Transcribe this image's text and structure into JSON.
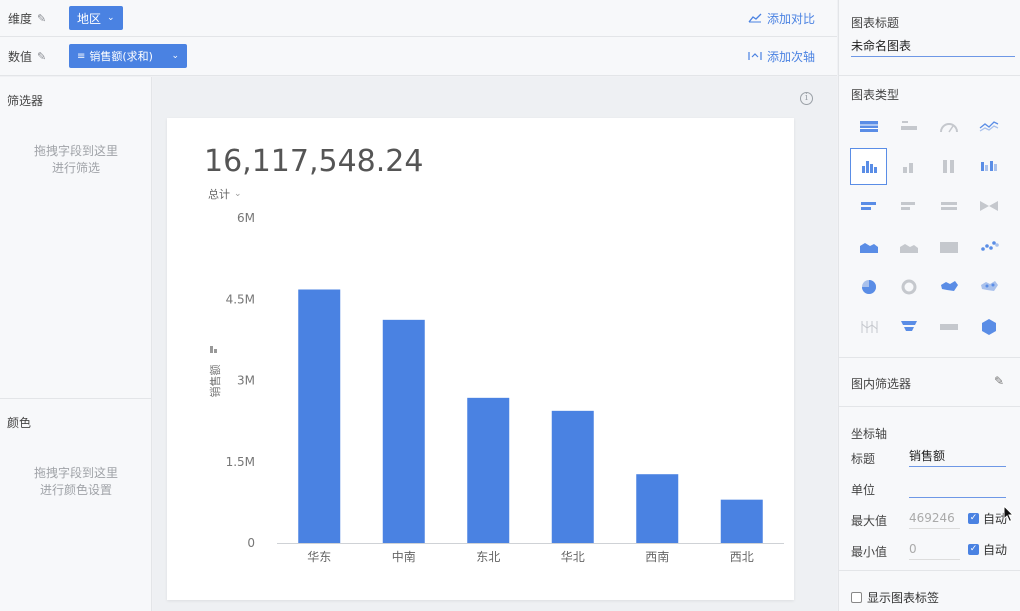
{
  "top": {
    "dimension_label": "维度",
    "dimension_chip": "地区",
    "add_compare": "添加对比",
    "value_label": "数值",
    "value_chip": "销售额(求和)",
    "add_secondary_axis": "添加次轴"
  },
  "left": {
    "filter_title": "筛选器",
    "filter_hint_1": "拖拽字段到这里",
    "filter_hint_2": "进行筛选",
    "color_title": "颜色",
    "color_hint_1": "拖拽字段到这里",
    "color_hint_2": "进行颜色设置"
  },
  "card": {
    "big_number": "16,117,548.24",
    "total_label": "总计"
  },
  "chart_data": {
    "type": "bar",
    "categories": [
      "华东",
      "中南",
      "东北",
      "华北",
      "西南",
      "西北"
    ],
    "values": [
      4680000,
      4120000,
      2680000,
      2440000,
      1270000,
      800000
    ],
    "ylabel": "销售额",
    "ylim": [
      0,
      6000000
    ],
    "yticks": [
      0,
      1500000,
      3000000,
      4500000,
      6000000
    ],
    "ytick_labels": [
      "0",
      "1.5M",
      "3M",
      "4.5M",
      "6M"
    ],
    "bar_color": "#4a82e2",
    "grid": false
  },
  "right": {
    "chart_title_label": "图表标题",
    "chart_title_value": "未命名图表",
    "chart_type_label": "图表类型",
    "chart_types": [
      "table-icon",
      "kpi-icon",
      "gauge-icon",
      "line-icon",
      "bar-icon",
      "stacked-bar-icon",
      "percent-bar-icon",
      "grouped-bar-icon",
      "hbar-icon",
      "stacked-hbar-icon",
      "percent-hbar-icon",
      "bidirectional-bar-icon",
      "area-icon",
      "stacked-area-icon",
      "percent-area-icon",
      "scatter-icon",
      "pie-icon",
      "ring-icon",
      "map-icon",
      "dot-map-icon",
      "parallel-icon",
      "funnel-icon",
      "wordcloud-icon",
      "liquid-icon"
    ],
    "inner_filter_label": "图内筛选器",
    "axis_label": "坐标轴",
    "axis_title_label": "标题",
    "axis_title_value": "销售额",
    "axis_unit_label": "单位",
    "axis_unit_value": "",
    "axis_max_label": "最大值",
    "axis_max_value": "469246",
    "axis_min_label": "最小值",
    "axis_min_value": "0",
    "auto_label": "自动",
    "show_labels": "显示图表标签",
    "accent": "#4a82e2"
  }
}
